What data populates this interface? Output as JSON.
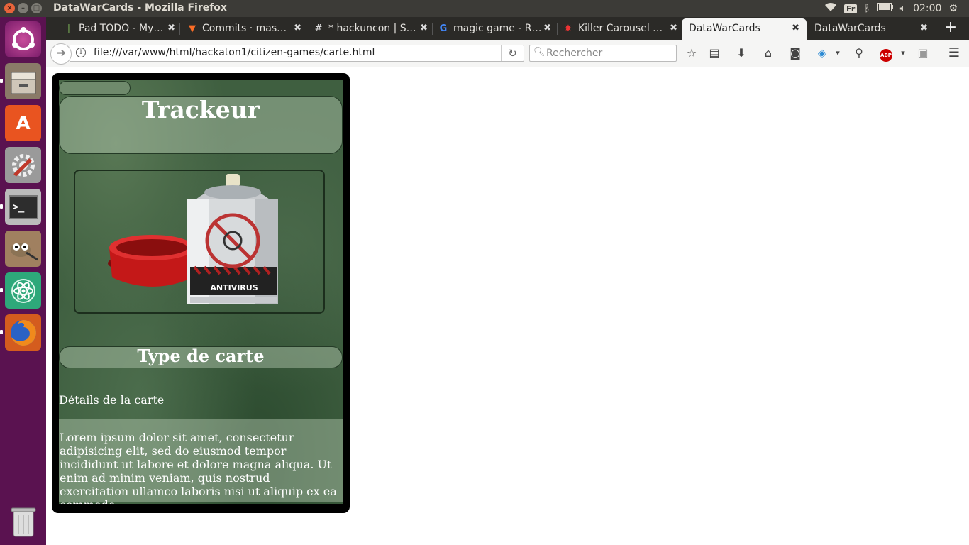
{
  "window": {
    "title": "DataWarCards - Mozilla Firefox"
  },
  "panel": {
    "keyboard": "Fr",
    "clock": "02:00"
  },
  "tabs": [
    {
      "label": "Pad TODO - My…",
      "icon": "pad-icon"
    },
    {
      "label": "Commits · mas…",
      "icon": "gitlab-icon"
    },
    {
      "label": "* hackuncon | S…",
      "icon": "slack-icon"
    },
    {
      "label": "magic game - R…",
      "icon": "google-icon"
    },
    {
      "label": "Killer Carousel …",
      "icon": "carousel-icon"
    },
    {
      "label": "DataWarCards",
      "icon": "",
      "active": true
    },
    {
      "label": "DataWarCards",
      "icon": ""
    }
  ],
  "navbar": {
    "url": "file:///var/www/html/hackaton1/citizen-games/carte.html",
    "search_placeholder": "Rechercher"
  },
  "card": {
    "title": "Trackeur",
    "image_caption": "ANTIVIRUS",
    "type": "Type de carte",
    "details": "Détails de la carte",
    "description": "Lorem ipsum dolor sit amet, consectetur adipisicing elit, sed do eiusmod tempor incididunt ut labore et dolore magna aliqua. Ut enim ad minim veniam, quis nostrud exercitation ullamco laboris nisi ut aliquip ex ea commodo"
  },
  "colors": {
    "launcher": "#5a1250",
    "panel": "#3c3b37",
    "card_border": "#000000",
    "card_bg": "#3f5f40"
  }
}
